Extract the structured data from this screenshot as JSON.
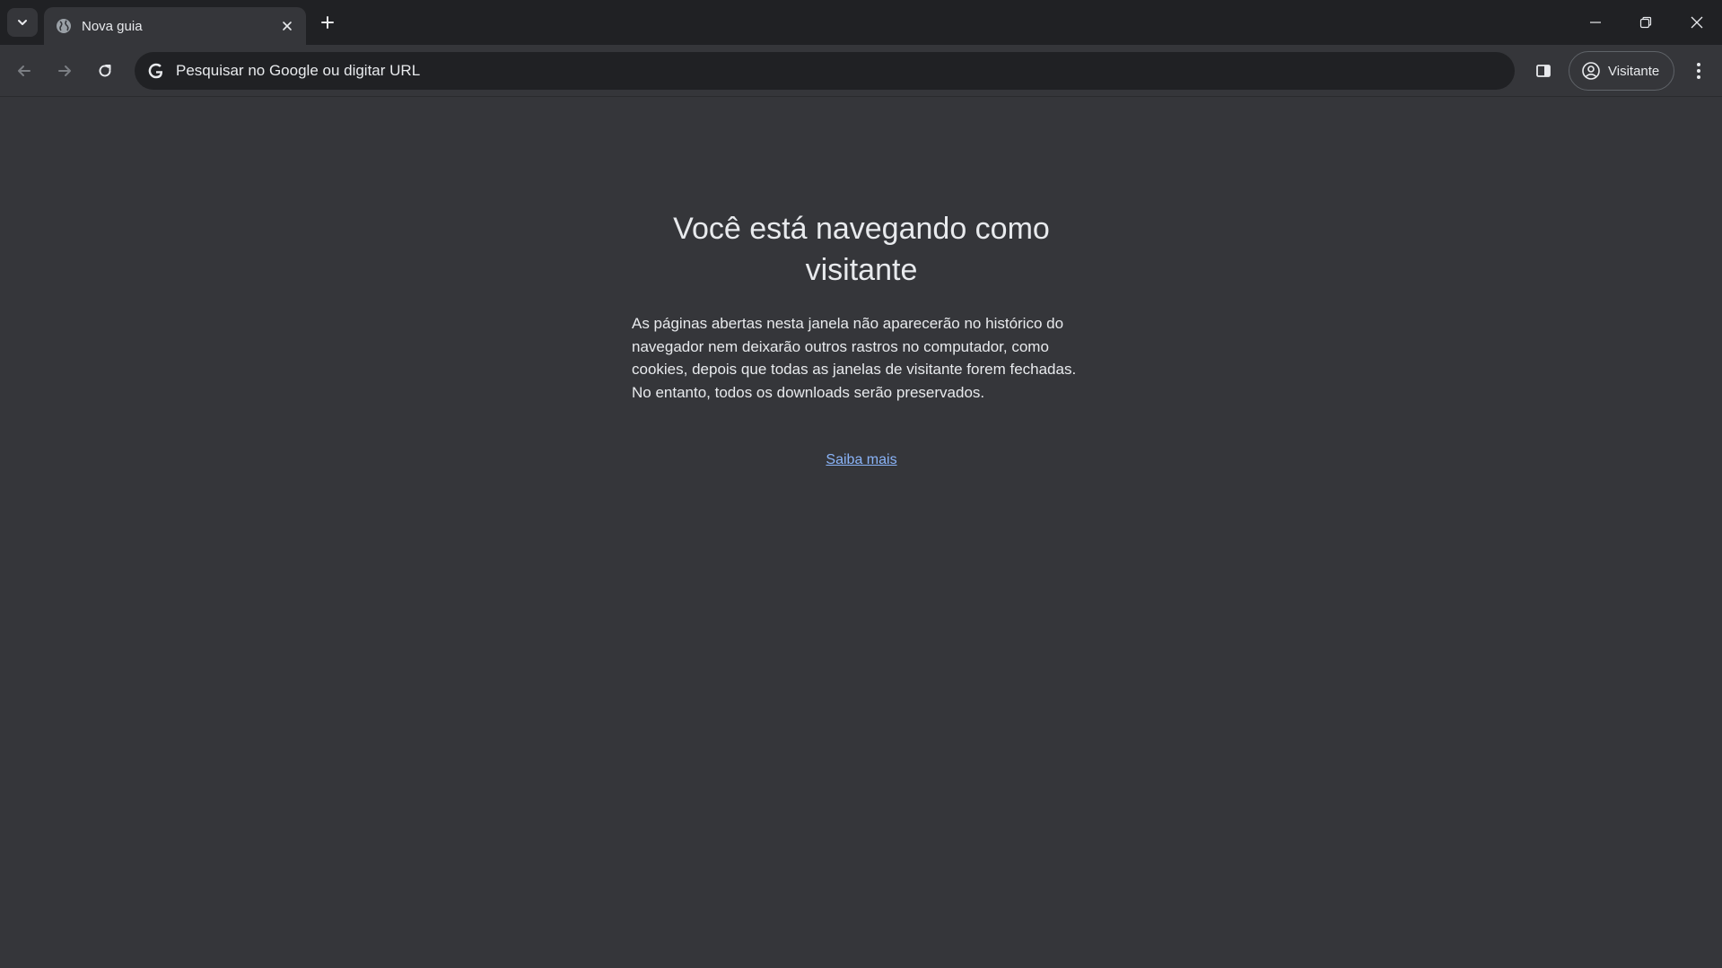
{
  "tab": {
    "title": "Nova guia",
    "favicon": "globe-icon"
  },
  "omnibox": {
    "placeholder": "Pesquisar no Google ou digitar URL",
    "value": ""
  },
  "profile": {
    "label": "Visitante"
  },
  "page": {
    "heading": "Você está navegando como visitante",
    "description": "As páginas abertas nesta janela não aparecerão no histórico do navegador nem deixarão outros rastros no computador, como cookies, depois que todas as janelas de visitante forem fechadas. No entanto, todos os downloads serão preservados.",
    "learn_more": "Saiba mais"
  },
  "colors": {
    "frame": "#202124",
    "toolbar": "#35363a",
    "text": "#e8eaed",
    "link": "#8ab4f8"
  }
}
